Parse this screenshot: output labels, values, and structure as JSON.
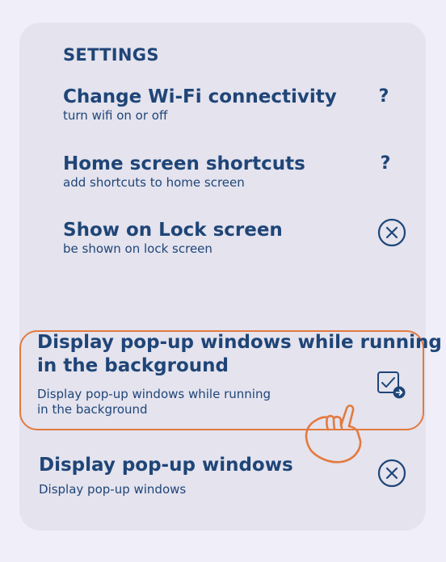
{
  "settings": {
    "title": "SETTINGS",
    "items": [
      {
        "title": "Change Wi-Fi connectivity",
        "subtitle": "turn wifi on or off",
        "action": "help-icon",
        "action_label": "?"
      },
      {
        "title": "Home screen shortcuts",
        "subtitle": "add shortcuts to home screen",
        "action": "help-icon",
        "action_label": "?"
      },
      {
        "title": "Show on Lock screen",
        "subtitle": "be shown on lock screen",
        "action": "close-circle-icon"
      },
      {
        "title_line1": "Display pop-up windows while running",
        "title_line2": "in the background",
        "subtitle_line1": "Display pop-up windows while running",
        "subtitle_line2": "in the background",
        "action": "checkbox-checked-icon",
        "highlighted": true
      },
      {
        "title": "Display pop-up windows",
        "subtitle": "Display pop-up windows",
        "action": "close-circle-icon"
      }
    ]
  },
  "colors": {
    "text": "#1f4577",
    "panel": "#e4e3ee",
    "background": "#efeef9",
    "highlight": "#e37a3f"
  }
}
